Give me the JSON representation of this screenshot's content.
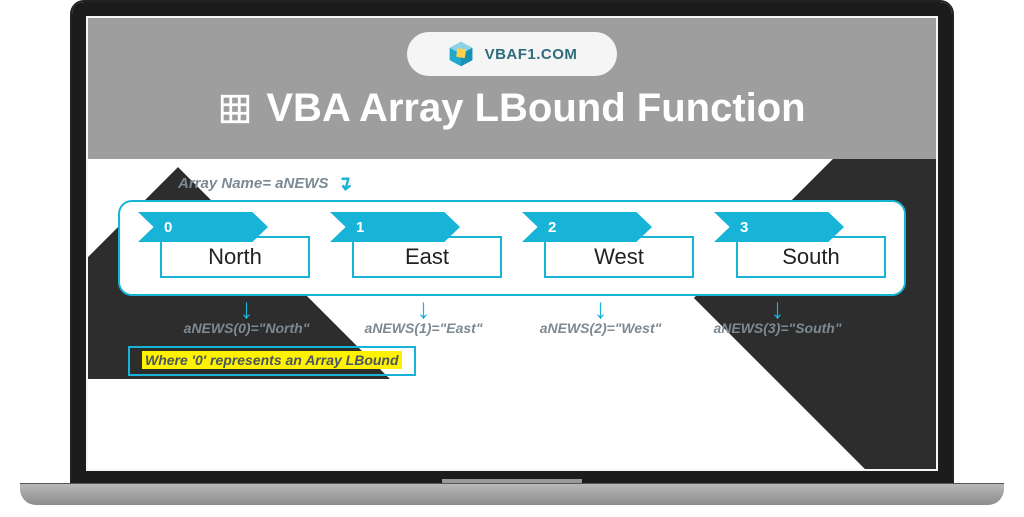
{
  "header": {
    "site": "VBAF1.COM",
    "title": "VBA Array LBound Function"
  },
  "diagram": {
    "array_name_label": "Array Name= aNEWS",
    "cells": [
      {
        "index": "0",
        "value": "North",
        "expr": "aNEWS(0)=\"North\""
      },
      {
        "index": "1",
        "value": "East",
        "expr": "aNEWS(1)=\"East\""
      },
      {
        "index": "2",
        "value": "West",
        "expr": "aNEWS(2)=\"West\""
      },
      {
        "index": "3",
        "value": "South",
        "expr": "aNEWS(3)=\"South\""
      }
    ],
    "note": "Where '0' represents an Array LBound"
  },
  "colors": {
    "accent": "#18b4d7",
    "header_bg": "#9e9e9e",
    "highlight": "#fff200",
    "muted_text": "#7c8a93"
  }
}
